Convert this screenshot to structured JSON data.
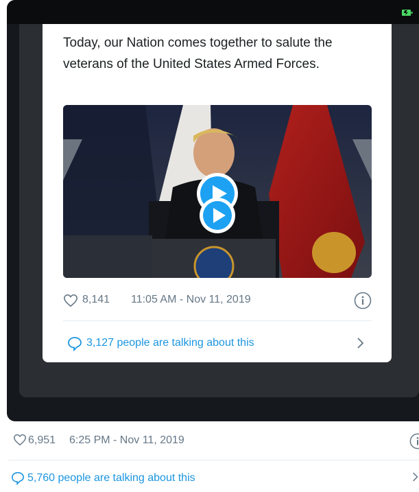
{
  "embedded_tweet": {
    "text": "Today, our Nation comes together to salute the veterans of the United States Armed Forces.",
    "likes": "8,141",
    "timestamp": "11:05 AM - Nov 11, 2019",
    "talking": "3,127 people are talking about this"
  },
  "outer_tweet": {
    "likes": "6,951",
    "timestamp": "6:25 PM - Nov 11, 2019",
    "talking": "5,760 people are talking about this"
  },
  "colors": {
    "link_blue": "#1b95e0",
    "meta_gray": "#657786",
    "battery_green": "#4cd964"
  },
  "icons": {
    "like": "heart-outline-icon",
    "info": "info-circle-icon",
    "reply": "speech-bubble-icon",
    "chevron": "chevron-right-icon",
    "play": "play-icon",
    "battery": "battery-icon"
  }
}
